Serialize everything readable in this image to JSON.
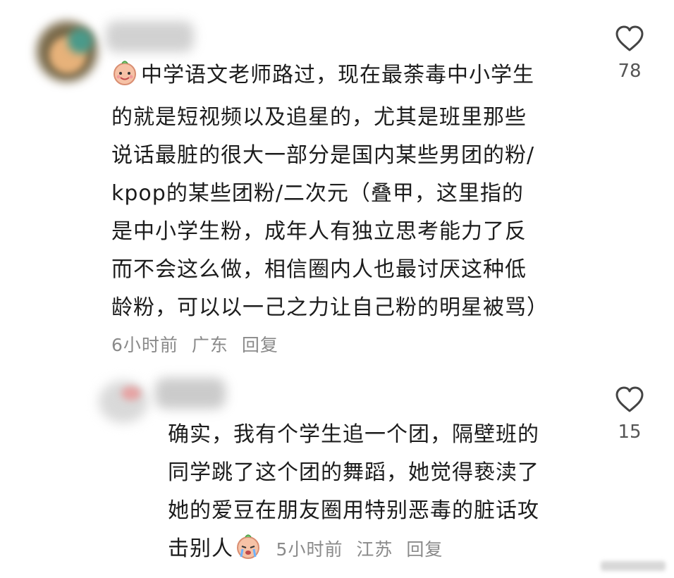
{
  "comments": [
    {
      "text_lines": [
        "中学语文老师路过，现在最荼毒中小学生",
        "的就是短视频以及追星的，尤其是班里那些",
        "说话最脏的很大一部分是国内某些男团的粉/",
        "kpop的某些团粉/二次元（叠甲，这里指的",
        "是中小学生粉，成年人有独立思考能力了反",
        "而不会这么做，相信圈内人也最讨厌这种低",
        "龄粉，可以以一己之力让自己粉的明星被骂）"
      ],
      "time": "6小时前",
      "location": "广东",
      "reply_label": "回复",
      "like_count": "78",
      "leading_emoji": "smiling-baby-emoji"
    },
    {
      "text_lines": [
        "确实，我有个学生追一个团，隔壁班的",
        "同学跳了这个团的舞蹈，她觉得亵渎了",
        "她的爱豆在朋友圈用特别恶毒的脏话攻",
        "击别人"
      ],
      "time": "5小时前",
      "location": "江苏",
      "reply_label": "回复",
      "like_count": "15",
      "trailing_emoji": "crying-baby-emoji"
    }
  ]
}
